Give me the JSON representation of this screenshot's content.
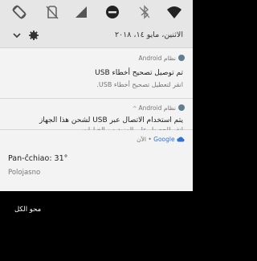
{
  "status_bar": {
    "icons": [
      "screen-rotation-icon",
      "no-sim-icon",
      "cellular-signal-icon",
      "do-not-disturb-icon",
      "bluetooth-off-icon",
      "wifi-icon"
    ]
  },
  "header": {
    "date": "الاثنين، مايو ١٤، ٢٠١٨"
  },
  "notifications": [
    {
      "app": "نظام Android",
      "title": "تم توصيل تصحيح أخطاء USB",
      "text": "انقر لتعطيل تصحيح أخطاء USB."
    },
    {
      "app": "نظام Android",
      "title": "يتم استخدام الاتصال عبر USB لشحن هذا الجهاز",
      "text": "انقر للحصول على المزيد من الخيارات."
    }
  ],
  "weather": {
    "source": "Google",
    "time": "الآن",
    "title": "Pan-ĉchiao: 31°",
    "location": "Polojasno"
  },
  "clear_all_label": "محو الكل",
  "colors": {
    "panel": "#e6e6e6",
    "card": "#f3f3f3",
    "accent_google": "#2f73d0",
    "background": "#000000"
  }
}
